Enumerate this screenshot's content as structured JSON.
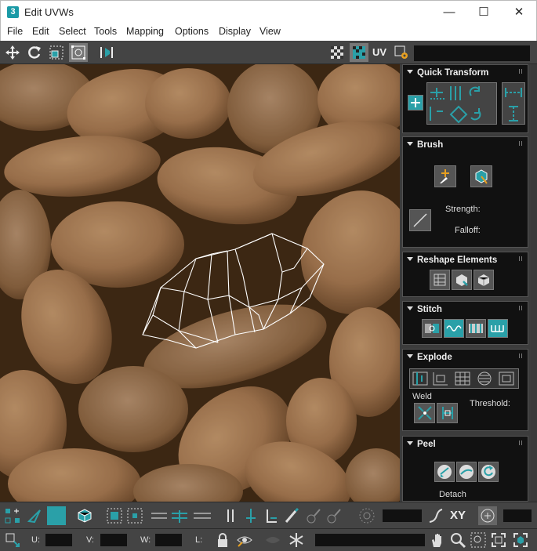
{
  "window": {
    "title": "Edit UVWs",
    "app_icon_text": "3",
    "minimize": "—",
    "maximize": "☐",
    "close": "✕"
  },
  "menu": [
    "File",
    "Edit",
    "Select",
    "Tools",
    "Mapping",
    "Options",
    "Display",
    "View"
  ],
  "toolbar": {
    "uv_label": "UV"
  },
  "colors": {
    "accent": "#2aa0a8",
    "panel_bg": "#111111",
    "chrome_bg": "#444444",
    "mesh_line": "#ffffff"
  },
  "rollouts": {
    "quick_transform": {
      "title": "Quick Transform"
    },
    "brush": {
      "title": "Brush",
      "strength_label": "Strength:",
      "falloff_label": "Falloff:"
    },
    "reshape": {
      "title": "Reshape Elements"
    },
    "stitch": {
      "title": "Stitch"
    },
    "explode": {
      "title": "Explode",
      "weld_label": "Weld",
      "threshold_label": "Threshold:"
    },
    "peel": {
      "title": "Peel",
      "detach_label": "Detach"
    }
  },
  "bottom": {
    "xy_label": "XY",
    "u_label": "U:",
    "v_label": "V:",
    "w_label": "W:",
    "l_label": "L:"
  },
  "viewport": {
    "background": "peanuts texture"
  }
}
